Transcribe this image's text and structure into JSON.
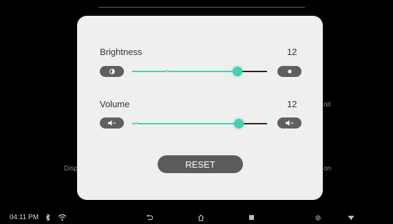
{
  "background": {
    "left_text": "Disp",
    "right_text_1": "nit",
    "right_text_2": "on"
  },
  "brightness": {
    "label": "Brightness",
    "value": "12",
    "level": 0.78,
    "left_icon": "brightness-low-icon",
    "right_icon": "brightness-high-icon"
  },
  "volume": {
    "label": "Volume",
    "value": "12",
    "level": 0.79,
    "left_icon": "volume-down-icon",
    "right_icon": "volume-up-icon"
  },
  "reset_label": "RESET",
  "status": {
    "time": "04:11 PM",
    "icons": [
      "bluetooth-icon",
      "wifi-icon"
    ]
  },
  "nav": [
    "back-icon",
    "home-icon",
    "recents-icon",
    "settings-icon",
    "dropdown-icon"
  ],
  "colors": {
    "accent": "#43d1b2",
    "pill": "#5f5f5f",
    "dialog": "#efefef"
  }
}
